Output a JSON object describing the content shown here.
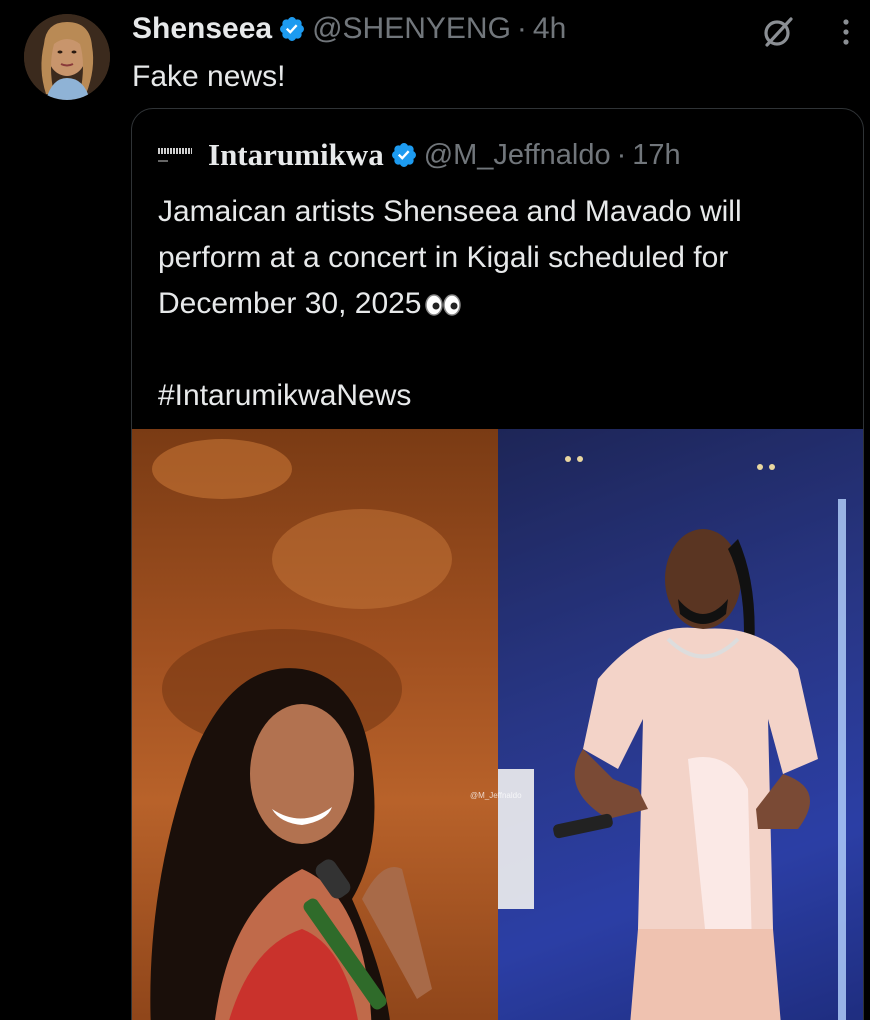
{
  "tweet": {
    "author_name": "Shenseea",
    "author_handle": "@SHENYENG",
    "separator": "·",
    "time": "4h",
    "text": "Fake news!"
  },
  "quoted_tweet": {
    "author_name": "Intarumikwa",
    "author_handle": "@M_Jeffnaldo",
    "separator": "·",
    "time": "17h",
    "lines": [
      "Jamaican artists Shenseea and Mavado will",
      "perform at a concert in Kigali scheduled for",
      "December 30, 2025"
    ],
    "hashtag": "#IntarumikwaNews",
    "media_watermark": "@M_Jeffnaldo"
  },
  "icons": {
    "verified": "verified-badge-icon",
    "grok": "grok-icon",
    "more": "more-options-icon",
    "eyes": "eyes-emoji-icon"
  },
  "colors": {
    "background": "#000000",
    "text": "#e7e9ea",
    "muted": "#71767b",
    "verified": "#1d9bf0",
    "border": "#2f3336"
  }
}
